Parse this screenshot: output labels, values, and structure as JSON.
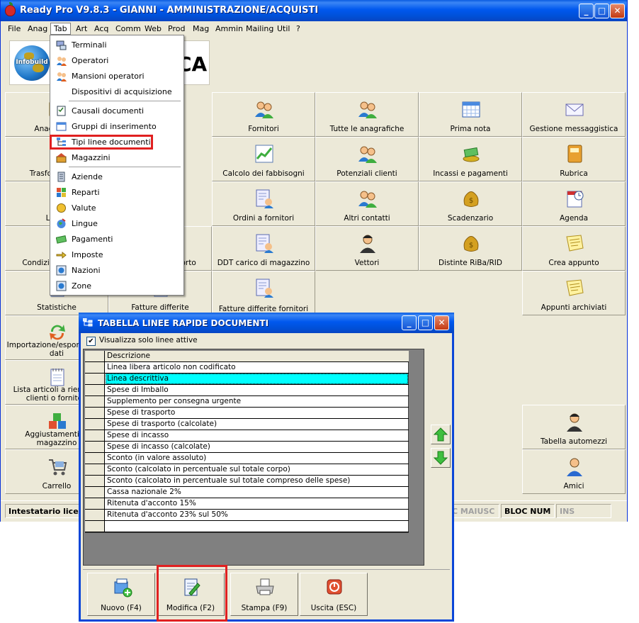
{
  "main_window": {
    "title": "Ready Pro V9.8.3 - GIANNI - AMMINISTRAZIONE/ACQUISTI",
    "controls": {
      "minimize": "_",
      "maximize": "□",
      "close": "✕"
    }
  },
  "menu_bar": [
    "File",
    "Anag",
    "Tab",
    "Art",
    "Acq",
    "Comm",
    "Web",
    "Prod",
    "Mag",
    "Ammin",
    "Mailing",
    "Util",
    "?"
  ],
  "logo": {
    "globe_text": "Infobuild",
    "letters": "CA"
  },
  "tiles": [
    {
      "label": "Anagrafiche",
      "icon": "user-card-icon"
    },
    {
      "label": "Fornitori",
      "icon": "people-icon"
    },
    {
      "label": "Tutte le anagrafiche",
      "icon": "people-group-icon"
    },
    {
      "label": "Prima nota",
      "icon": "calendar-icon"
    },
    {
      "label": "Gestione messaggistica",
      "icon": "envelope-icon"
    },
    {
      "label": "Trasformazioni",
      "icon": "transform-icon"
    },
    {
      "label": "Calcolo dei fabbisogni",
      "icon": "chart-icon"
    },
    {
      "label": "Potenziali clienti",
      "icon": "people-group-icon"
    },
    {
      "label": "Incassi e pagamenti",
      "icon": "money-icon"
    },
    {
      "label": "Rubrica",
      "icon": "address-book-icon"
    },
    {
      "label": "Listini",
      "icon": "list-icon"
    },
    {
      "label": "Ordini a fornitori",
      "icon": "order-icon"
    },
    {
      "label": "Altri contatti",
      "icon": "people-group-icon"
    },
    {
      "label": "Scadenzario",
      "icon": "money-bag-icon"
    },
    {
      "label": "Agenda",
      "icon": "agenda-icon"
    },
    {
      "label": "Condizioni speciali",
      "icon": "document-icon"
    },
    {
      "label": "Fatture di trasporto",
      "icon": "document-icon"
    },
    {
      "label": "DDT carico di magazzino",
      "icon": "order-icon"
    },
    {
      "label": "Vettori",
      "icon": "driver-icon"
    },
    {
      "label": "Distinte RiBa/RID",
      "icon": "money-bag-icon"
    },
    {
      "label": "Crea appunto",
      "icon": "note-icon"
    },
    {
      "label": "Statistiche",
      "icon": "stats-icon"
    },
    {
      "label": "Fatture differite",
      "icon": "document-icon"
    },
    {
      "label": "Fatture differite fornitori",
      "icon": "order-icon"
    },
    {
      "label": "Appunti archiviati",
      "icon": "note-icon"
    },
    {
      "label": "Importazione/esportazione dati",
      "icon": "refresh-icon"
    },
    {
      "label": "Lista articoli a rientrare clienti o fornitori",
      "icon": "notepad-icon"
    },
    {
      "label": "Aggiustamenti di magazzino",
      "icon": "boxes-icon"
    },
    {
      "label": "Tabella automezzi",
      "icon": "driver-icon"
    },
    {
      "label": "Carrello",
      "icon": "cart-icon"
    },
    {
      "label": "Amici",
      "icon": "person-icon"
    }
  ],
  "status_bar": {
    "license": "Intestatario licenza",
    "caps": "C MAIUSC",
    "num": "BLOC NUM",
    "ins": "INS"
  },
  "tab_menu": {
    "items": [
      {
        "label": "Terminali",
        "icon": "terminal-icon"
      },
      {
        "label": "Operatori",
        "icon": "operators-icon"
      },
      {
        "label": "Mansioni operatori",
        "icon": "operators-icon"
      },
      {
        "label": "Dispositivi di acquisizione",
        "icon": ""
      },
      {
        "label": "Causali documenti",
        "icon": "checklist-icon"
      },
      {
        "label": "Gruppi di inserimento",
        "icon": "window-icon"
      },
      {
        "label": "Tipi linee documenti",
        "icon": "tree-icon"
      },
      {
        "label": "Magazzini",
        "icon": "warehouse-icon"
      },
      {
        "label": "Aziende",
        "icon": "building-icon"
      },
      {
        "label": "Reparti",
        "icon": "departments-icon"
      },
      {
        "label": "Valute",
        "icon": "coin-icon"
      },
      {
        "label": "Lingue",
        "icon": "globe-icon"
      },
      {
        "label": "Pagamenti",
        "icon": "payment-icon"
      },
      {
        "label": "Imposte",
        "icon": "tax-icon"
      },
      {
        "label": "Nazioni",
        "icon": "nation-icon"
      },
      {
        "label": "Zone",
        "icon": "zone-icon"
      }
    ]
  },
  "dialog": {
    "title": "TABELLA LINEE RAPIDE DOCUMENTI",
    "checkbox_label": "Visualizza solo linee attive",
    "checkbox_checked": true,
    "column_header": "Descrizione",
    "rows": [
      "Linea libera articolo non codificato",
      "Linea descrittiva",
      "Spese di Imballo",
      "Supplemento per consegna urgente",
      "Spese di trasporto",
      "Spese di trasporto (calcolate)",
      "Spese di incasso",
      "Spese di incasso (calcolate)",
      "Sconto (in valore assoluto)",
      "Sconto (calcolato in percentuale sul totale corpo)",
      "Sconto (calcolato in percentuale sul totale compreso delle spese)",
      "Cassa nazionale 2%",
      "Ritenuta d'acconto 15%",
      "Ritenuta d'acconto 23% sul 50%",
      ""
    ],
    "selected_row": 1,
    "buttons": {
      "new": "Nuovo (F4)",
      "edit": "Modifica (F2)",
      "print": "Stampa (F9)",
      "exit": "Uscita (ESC)"
    }
  },
  "colors": {
    "title_blue": "#0058ee",
    "highlight_red": "#e02020",
    "selected_row": "#00ffff",
    "window_bg": "#ece9d8"
  }
}
